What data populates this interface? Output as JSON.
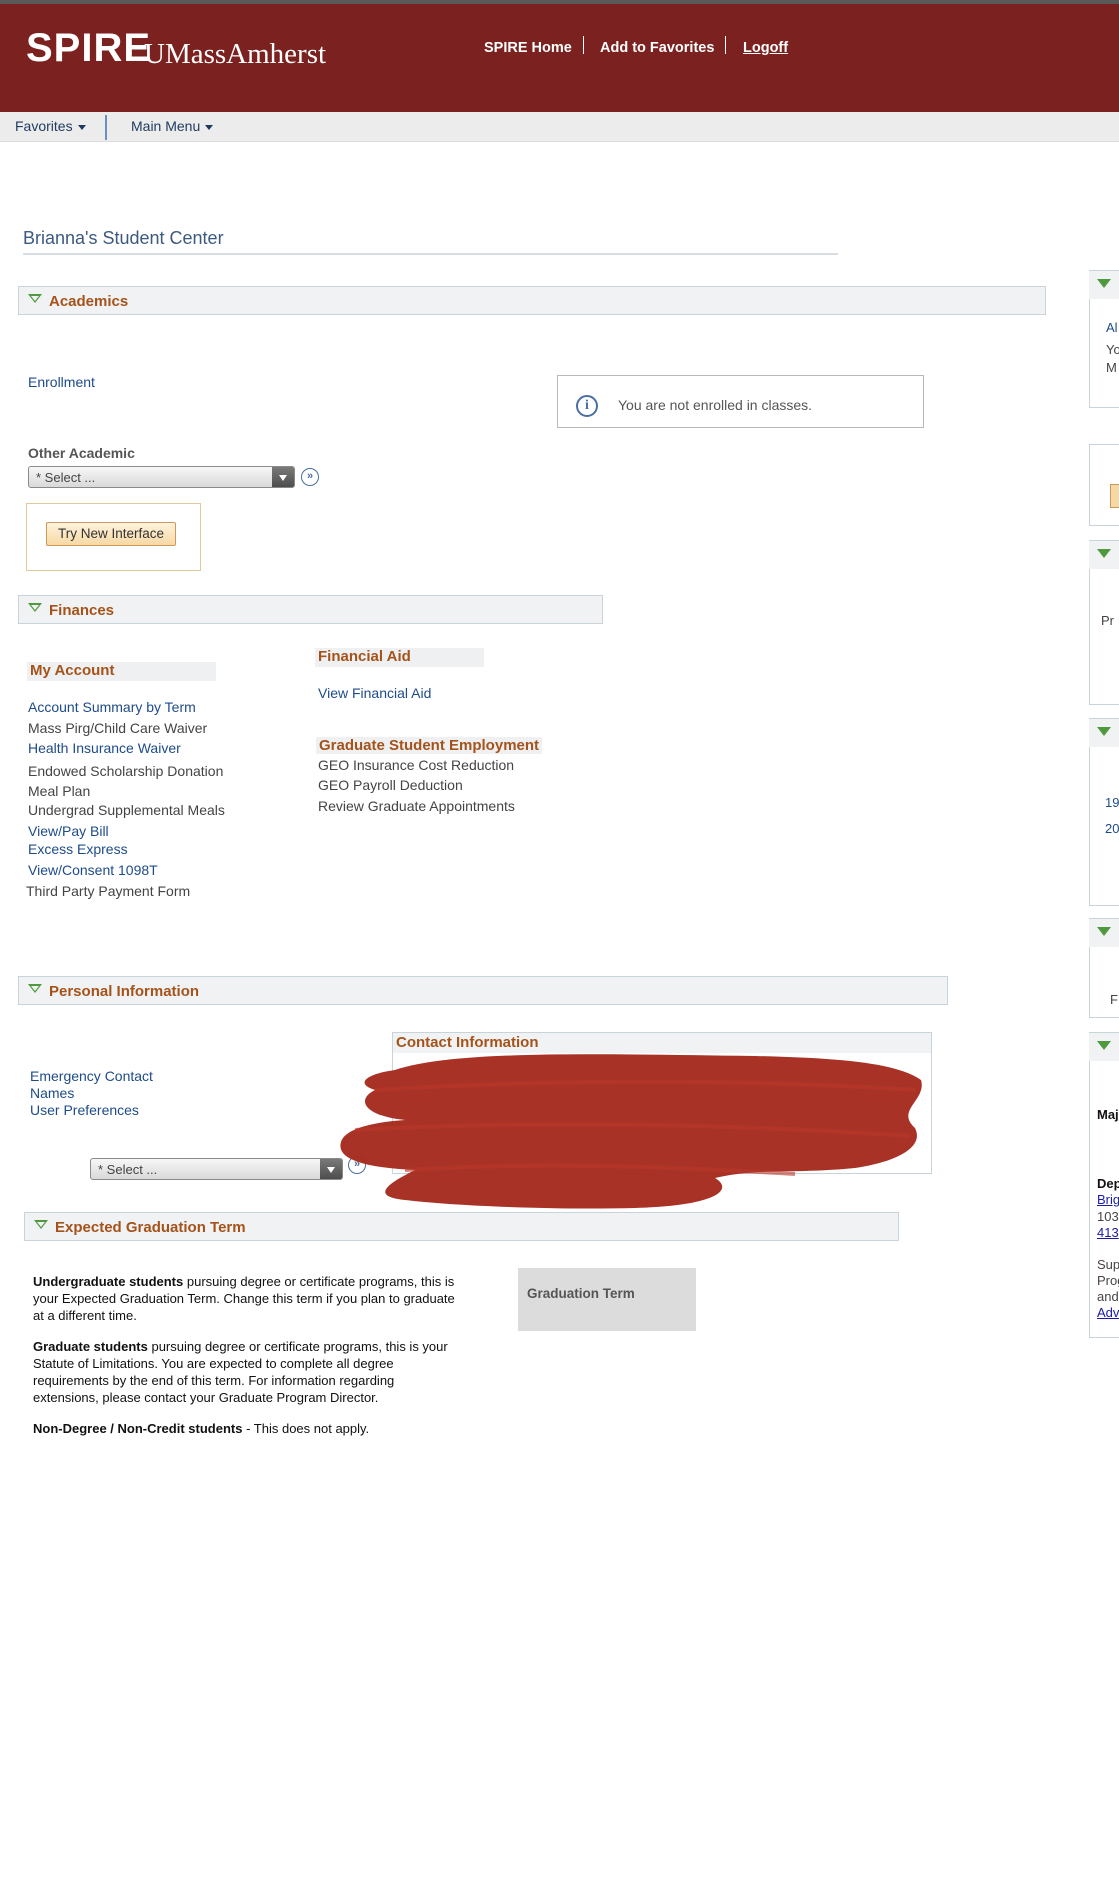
{
  "header": {
    "logo_spire": "SPIRE",
    "logo_umass": "UMassAmherst",
    "links": [
      "SPIRE Home",
      "Add to Favorites",
      "Logoff"
    ]
  },
  "menubar": {
    "favorites": "Favorites",
    "main_menu": "Main Menu"
  },
  "page_title": "Brianna's Student Center",
  "academics": {
    "label": "Academics",
    "enrollment": "Enrollment",
    "info_message": "You are not enrolled in classes.",
    "other_academic_label": "Other Academic",
    "other_academic_select": "* Select ...",
    "try_new_interface": "Try New Interface"
  },
  "finances": {
    "label": "Finances",
    "my_account": {
      "heading": "My Account",
      "items": [
        "Account Summary by Term",
        "Mass Pirg/Child Care Waiver",
        "Health Insurance Waiver",
        "Endowed Scholarship Donation",
        "Meal Plan",
        "Undergrad Supplemental Meals",
        "View/Pay Bill",
        "Excess Express",
        "View/Consent 1098T",
        "Third Party Payment Form"
      ]
    },
    "financial_aid": {
      "heading": "Financial Aid",
      "link": "View Financial Aid"
    },
    "grad_employment": {
      "heading": "Graduate Student Employment",
      "items": [
        "GEO Insurance Cost Reduction",
        "GEO Payroll Deduction",
        "Review Graduate Appointments"
      ]
    }
  },
  "personal": {
    "label": "Personal Information",
    "links": [
      "Emergency Contact",
      "Names",
      "User Preferences"
    ],
    "select": "* Select ...",
    "contact_heading": "Contact Information"
  },
  "graduation": {
    "label": "Expected Graduation Term",
    "ug_bold": "Undergraduate students",
    "ug_text": " pursuing degree or certificate programs, this is your Expected Graduation Term. Change this term if you plan to graduate at a different time.",
    "grad_bold": "Graduate students",
    "grad_text": " pursuing degree or certificate programs, this is your Statute of Limitations. You are expected to complete all degree requirements by the end of this term. For information regarding extensions, please contact your Graduate Program Director.",
    "nd_bold": "Non-Degree / Non-Credit students",
    "nd_text": " - This does not apply.",
    "term_label": "Graduation Term"
  },
  "right_column": {
    "a1": "Al",
    "a2": "Yo",
    "a3": "M",
    "pr": "Pr",
    "n19": "19",
    "n20": "20",
    "f": "F",
    "maj": "Maj",
    "dep": "Dep",
    "brig": "Brig",
    "n103": "103",
    "n413": "413",
    "sup": "Sup",
    "prog": "Prog",
    "and": "and",
    "adv": "Adv"
  },
  "colors": {
    "header_bg": "#7b2220",
    "section_label": "#a5531a",
    "link": "#1e4b8a",
    "redaction": "#a52a1e"
  }
}
